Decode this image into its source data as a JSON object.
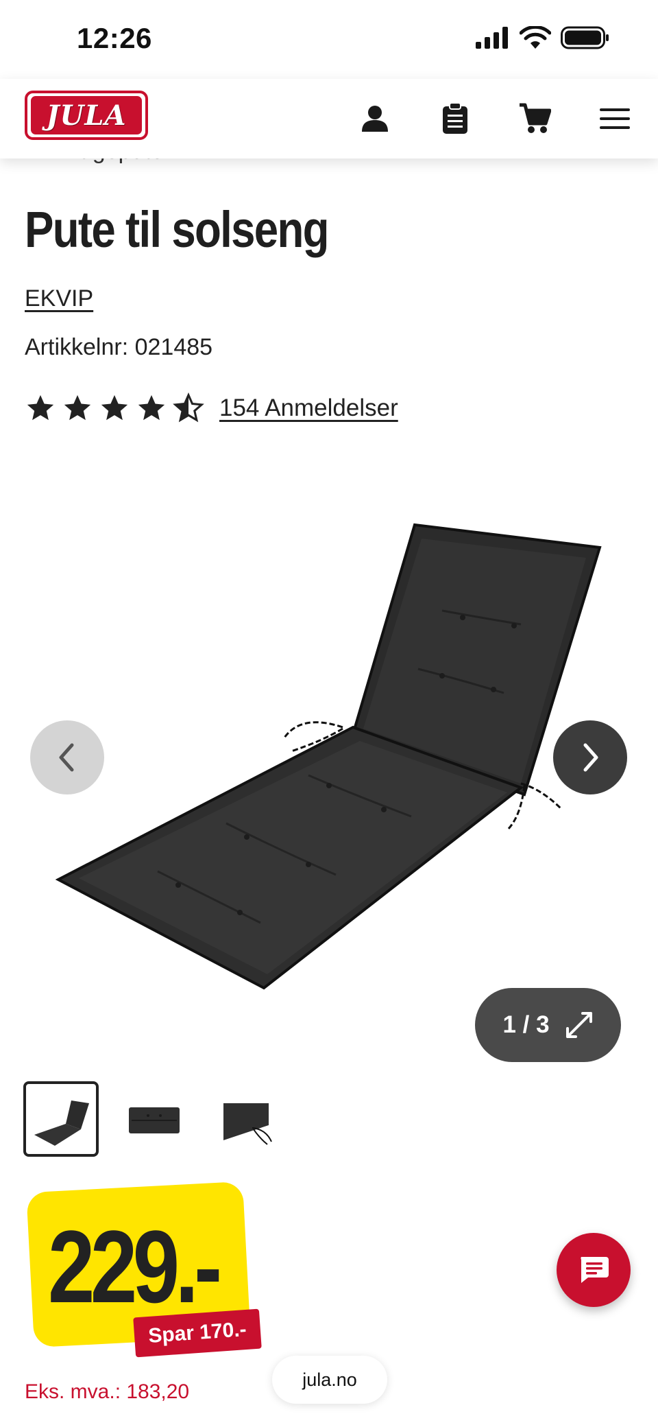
{
  "status_bar": {
    "time": "12:26"
  },
  "header": {
    "logo_text": "JULA",
    "icons": [
      "account-icon",
      "shopping-list-icon",
      "cart-icon",
      "menu-icon"
    ]
  },
  "breadcrumb": {
    "label": "Hageputer"
  },
  "product": {
    "title": "Pute til solseng",
    "brand": "EKVIP",
    "article_number": "Artikkelnr: 021485",
    "rating": 4.5,
    "reviews": "154 Anmeldelser"
  },
  "gallery": {
    "counter": "1 / 3",
    "thumbnail_count": 3
  },
  "price": {
    "value": "229.-",
    "save": "Spar 170.-",
    "ex_vat": "Eks. mva.: 183,20"
  },
  "browser": {
    "url": "jula.no"
  },
  "colors": {
    "brand_red": "#c8102e",
    "price_yellow": "#ffe500",
    "text_dark": "#1f1f1f"
  }
}
